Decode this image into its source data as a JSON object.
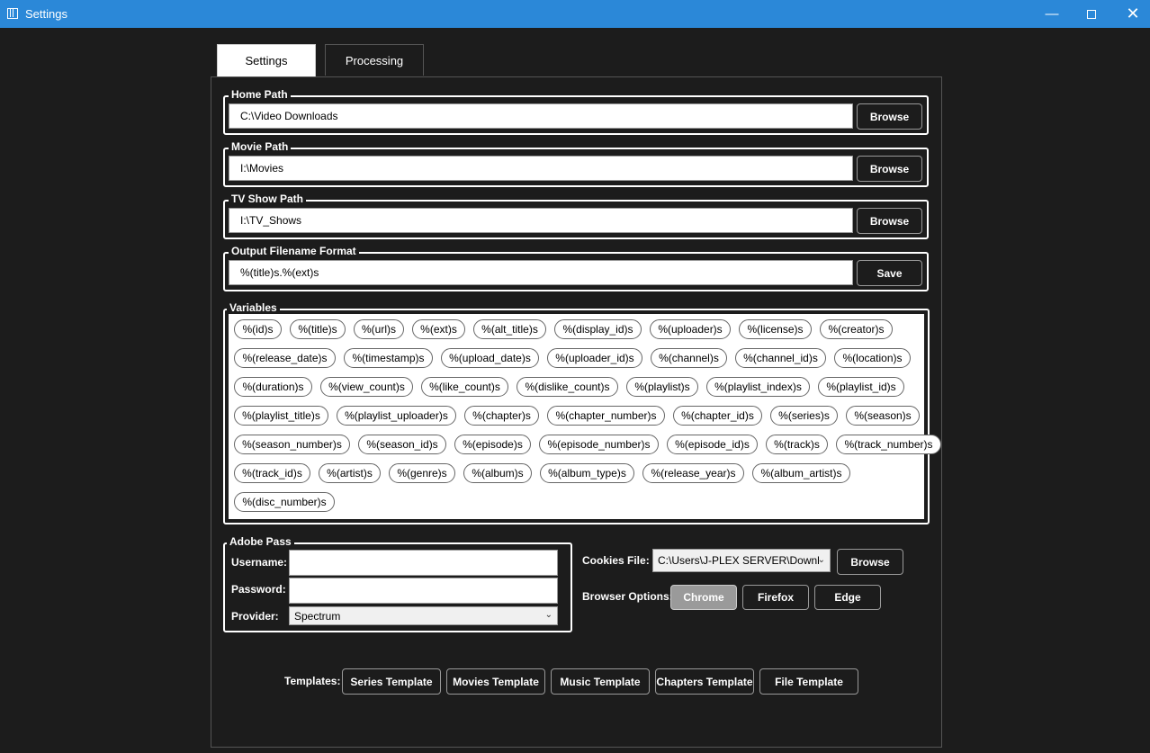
{
  "window": {
    "title": "Settings"
  },
  "tabs": [
    {
      "label": "Settings"
    },
    {
      "label": "Processing"
    }
  ],
  "paths": {
    "home": {
      "legend": "Home Path",
      "value": "C:\\Video Downloads",
      "button": "Browse"
    },
    "movie": {
      "legend": "Movie Path",
      "value": "I:\\Movies",
      "button": "Browse"
    },
    "tv": {
      "legend": "TV Show Path",
      "value": "I:\\TV_Shows",
      "button": "Browse"
    },
    "output": {
      "legend": "Output Filename Format",
      "value": "%(title)s.%(ext)s",
      "button": "Save"
    }
  },
  "variables": {
    "legend": "Variables",
    "rows": [
      [
        "%(id)s",
        "%(title)s",
        "%(url)s",
        "%(ext)s",
        "%(alt_title)s",
        "%(display_id)s",
        "%(uploader)s",
        "%(license)s",
        "%(creator)s"
      ],
      [
        "%(release_date)s",
        "%(timestamp)s",
        "%(upload_date)s",
        "%(uploader_id)s",
        "%(channel)s",
        "%(channel_id)s",
        "%(location)s"
      ],
      [
        "%(duration)s",
        "%(view_count)s",
        "%(like_count)s",
        "%(dislike_count)s",
        "%(playlist)s",
        "%(playlist_index)s",
        "%(playlist_id)s"
      ],
      [
        "%(playlist_title)s",
        "%(playlist_uploader)s",
        "%(chapter)s",
        "%(chapter_number)s",
        "%(chapter_id)s",
        "%(series)s",
        "%(season)s"
      ],
      [
        "%(season_number)s",
        "%(season_id)s",
        "%(episode)s",
        "%(episode_number)s",
        "%(episode_id)s",
        "%(track)s",
        "%(track_number)s"
      ],
      [
        "%(track_id)s",
        "%(artist)s",
        "%(genre)s",
        "%(album)s",
        "%(album_type)s",
        "%(release_year)s",
        "%(album_artist)s"
      ],
      [
        "%(disc_number)s"
      ]
    ]
  },
  "adobe_pass": {
    "legend": "Adobe Pass",
    "username_label": "Username:",
    "username_value": "",
    "password_label": "Password:",
    "password_value": "",
    "provider_label": "Provider:",
    "provider_value": "Spectrum"
  },
  "cookies": {
    "label": "Cookies File:",
    "value": "C:\\Users\\J-PLEX SERVER\\Downl",
    "button": "Browse"
  },
  "browser_options": {
    "label": "Browser Options:",
    "options": [
      "Chrome",
      "Firefox",
      "Edge"
    ],
    "selected": "Chrome"
  },
  "templates": {
    "label": "Templates:",
    "buttons": [
      "Series Template",
      "Movies Template",
      "Music Template",
      "Chapters Template",
      "File Template"
    ]
  }
}
